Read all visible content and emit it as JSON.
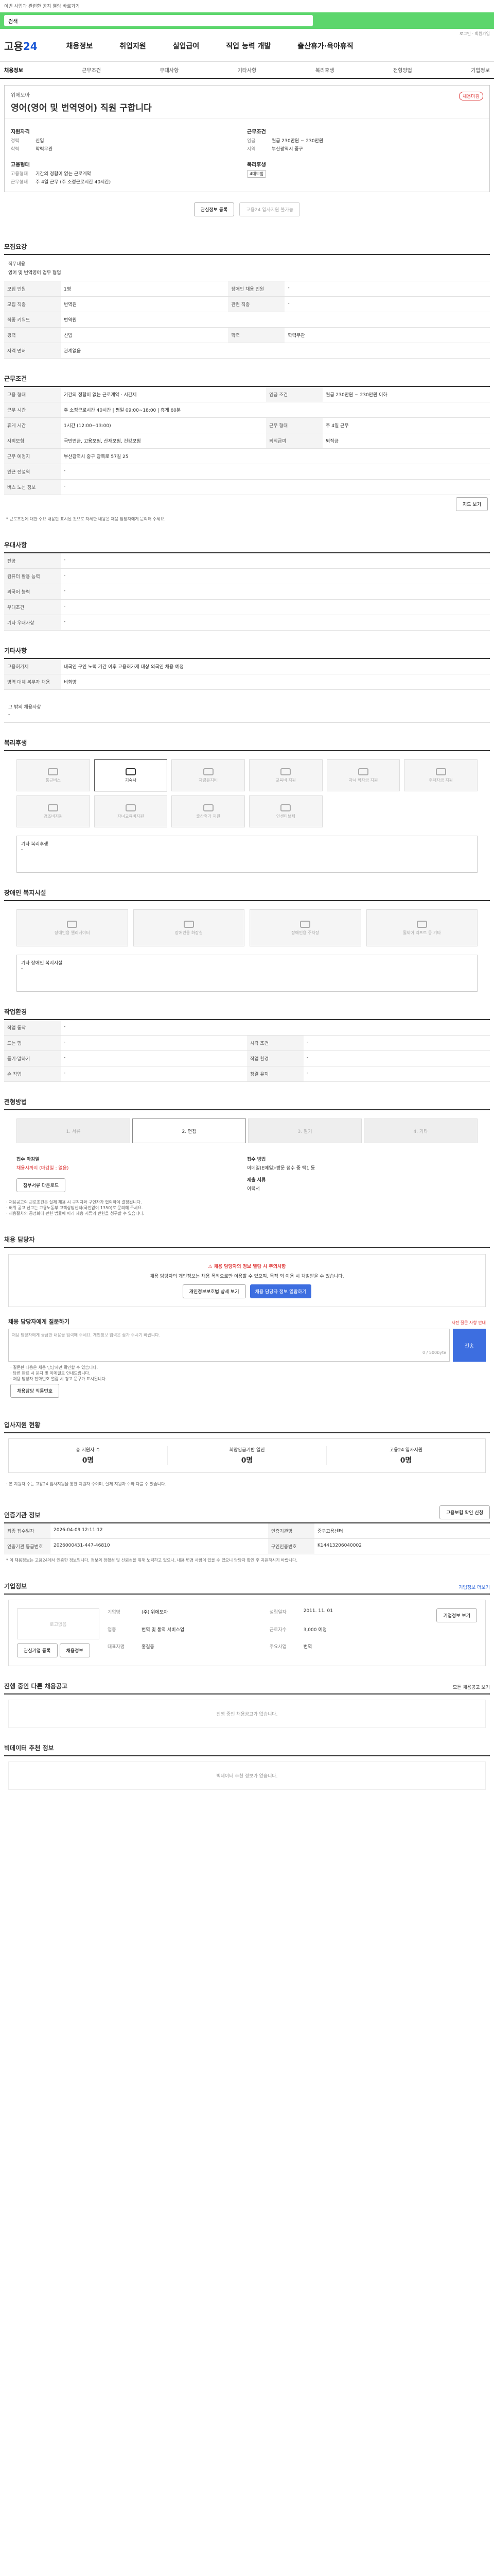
{
  "header": {
    "notice": "이번 사업과 관련한 공지 열람 바로가기",
    "search_value": "검색",
    "logo_a": "고용",
    "logo_b": "24",
    "nav": [
      "채용정보",
      "취업지원",
      "실업급여",
      "직업 능력 개발",
      "출산휴가·육아휴직"
    ],
    "util": "로그인 · 회원가입"
  },
  "lnb": [
    "채용정보",
    "근무조건",
    "우대사항",
    "기타사항",
    "복리후생",
    "전형방법",
    "기업정보"
  ],
  "job": {
    "company": "위에모아",
    "title": "영어(영어 및 번역영어) 직원 구합니다",
    "badge": "채용마감",
    "qual_title": "지원자격",
    "qual": [
      [
        "경력",
        "신입"
      ],
      [
        "학력",
        "학력무관"
      ]
    ],
    "qual2_title": "고용형태",
    "qual2": [
      [
        "고용형태",
        "기간의 정함이 없는 근로계약"
      ],
      [
        "근무형태",
        "주 4일 근무 (주 소정근로시간 40시간)"
      ]
    ],
    "cond_title": "근무조건",
    "cond": [
      [
        "임금",
        "월급 230만원 ~ 230만원"
      ],
      [
        "지역",
        "부산광역시 중구"
      ]
    ],
    "welfare_title": "복리후생",
    "welfare_tag": "4대보험",
    "btn_scrap": "관심정보 등록",
    "btn_apply": "고용24 입사지원 불가능"
  },
  "sec_recruit": {
    "title": "모집요강",
    "duty_label": "직무내용",
    "duty": "영어 및 번역영어 업무 협업",
    "rows": [
      [
        "모집 인원",
        "1명",
        "장애인 채용 인원",
        "-"
      ],
      [
        "모집 직종",
        "번역원",
        "관련 직종",
        "-"
      ],
      [
        "직종 키워드",
        "번역원",
        "",
        ""
      ],
      [
        "경력",
        "신입",
        "학력",
        "학력무관"
      ],
      [
        "자격 면허",
        "관계없음",
        "",
        ""
      ]
    ]
  },
  "sec_cond": {
    "title": "근무조건",
    "rows": [
      [
        "고용 형태",
        "기간의 정함이 없는 근로계약 · 시간제",
        "임금 조건",
        "월급 230만원 ~ 230만원 이하"
      ],
      [
        "근무 시간",
        "주 소정근로시간 40시간 | 평일 09:00~18:00 | 휴게 60분",
        "",
        ""
      ],
      [
        "휴게 시간",
        "1시간 (12:00~13:00)",
        "근무 형태",
        "주 4일 근무"
      ],
      [
        "사회보험",
        "국민연금, 고용보험, 산재보험, 건강보험",
        "퇴직급여",
        "퇴직금"
      ],
      [
        "근무 예정지",
        "부산광역시 중구 광복로 57길 25",
        "",
        ""
      ],
      [
        "인근 전철역",
        "-",
        "",
        ""
      ],
      [
        "버스 노선 정보",
        "-",
        "",
        ""
      ]
    ],
    "map_btn": "지도 보기",
    "note": "* 근로조건에 대한 주요 내용만 표시된 것으로 자세한 내용은 채용 담당자에게 문의해 주세요."
  },
  "sec_pref": {
    "title": "우대사항",
    "rows": [
      [
        "전공",
        "-"
      ],
      [
        "컴퓨터 활용 능력",
        "-"
      ],
      [
        "외국어 능력",
        "-"
      ],
      [
        "우대조건",
        "-"
      ],
      [
        "기타 우대사항",
        "-"
      ]
    ]
  },
  "sec_etc": {
    "title": "기타사항",
    "rows": [
      [
        "고용허가제",
        "내국인 구인 노력 기간 이후 고용허가제 대상 외국인 채용 예정"
      ],
      [
        "병역 대체 복무자 채용",
        "비희망"
      ]
    ],
    "extra_label": "그 밖의 채용사항",
    "extra": "-"
  },
  "sec_welfare": {
    "title": "복리후생",
    "items": [
      "통근버스",
      "기숙사",
      "차량유지비",
      "교육비 지원",
      "자녀 학자금 지원",
      "주택자금 지원",
      "경조비지원",
      "자녀교육비지원",
      "출산휴가 지원",
      "인센티브제"
    ],
    "active": 1,
    "other_label": "기타 복리후생",
    "other": "-"
  },
  "sec_disabled": {
    "title": "장애인 복지시설",
    "items": [
      "장애인용 엘리베이터",
      "장애인용 화장실",
      "장애인용 주차장",
      "휠체어 리프트 등 기타"
    ],
    "other_label": "기타 장애인 복지시설",
    "other": "-"
  },
  "sec_env": {
    "title": "작업환경",
    "rows": [
      [
        "작업 동작",
        "-",
        "",
        ""
      ],
      [
        "드는 힘",
        "-",
        "시각 조건",
        "-"
      ],
      [
        "듣기·말하기",
        "-",
        "작업 환경",
        "-"
      ],
      [
        "손 작업",
        "-",
        "청결 유지",
        "-"
      ]
    ]
  },
  "sec_process": {
    "title": "전형방법",
    "steps": [
      "1. 서류",
      "2. 면접",
      "3. 필기",
      "4. 기타"
    ],
    "active": 1,
    "deadline_label": "접수 마감일",
    "deadline": "채용시까지 (마감일 : 없음)",
    "method_label": "접수 방법",
    "method": "이메일(E메일)·방문 접수 중 택1 등",
    "docs_label": "제출 서류",
    "docs": "이력서",
    "doc_btn": "첨부서류 다운로드",
    "notes": [
      "· 채용공고의 근로조건은 실제 채용 시 구직자와 구인자가 협의하여 결정됩니다.",
      "· 허위 공고 신고는 고용노동부 고객상담센터(국번없이 1350)로 문의해 주세요.",
      "· 채용절차의 공정화에 관한 법률에 따라 채용 서류의 반환을 청구할 수 있습니다."
    ]
  },
  "sec_manager": {
    "title": "채용 담당자",
    "warn_title": "채용 담당자의 정보 열람 시 주의사항",
    "warn_body": "채용 담당자의 개인정보는 채용 목적으로만 이용할 수 있으며, 목적 외 이용 시 처벌받을 수 있습니다.",
    "btn_view": "개인정보보호법 상세 보기",
    "btn_confirm": "채용 담당자 정보 열람하기",
    "qna_label": "채용 담당자에게 질문하기",
    "qna_note": "사전 질문 사항 안내",
    "qna_placeholder": "채용 담당자에게 궁금한 내용을 입력해 주세요. 개인정보 입력은 삼가 주시기 바랍니다.",
    "qna_count": "0 / 500byte",
    "qna_btn": "전송",
    "foot": [
      "· 질문한 내용은 채용 담당자만 확인할 수 있습니다.",
      "· 답변 완료 시 문자 및 이메일로 안내드립니다.",
      "· 채용 담당자 전화번호 열람 시 경고 문구가 표시됩니다."
    ],
    "foot_btn": "채용담당 직통번호"
  },
  "sec_status": {
    "title": "입사지원 현황",
    "items": [
      [
        "총 지원자 수",
        "0명"
      ],
      [
        "희망임금기반 열진",
        "0명"
      ],
      [
        "고용24 입사지원",
        "0명"
      ]
    ],
    "note": "· 본 지원자 수는 고용24 입사지원을 통한 지원자 수이며, 실제 지원자 수와 다를 수 있습니다."
  },
  "sec_info": {
    "title": "인증기관 정보",
    "btn": "고용보험 확인 신청",
    "rows": [
      [
        "최종 접수일자",
        "2026-04-09 12:11:12",
        "인증기관명",
        "중구고용센터"
      ],
      [
        "인증기관 등급번호",
        "2026000431-447-46810",
        "구인인증번호",
        "K14413206040002"
      ]
    ],
    "note": "* 이 채용정보는 고용24에서 인증한 정보입니다. 정보의 정확성 및 신뢰성을 위해 노력하고 있으나, 내용 변경 사항이 있을 수 있으니 담당자 확인 후 지원하시기 바랍니다."
  },
  "sec_company": {
    "title": "기업정보",
    "link": "기업정보 더보기",
    "logo_text": "로고없음",
    "btn1": "관심기업 등록",
    "btn2": "채용정보",
    "rows": [
      [
        "기업명",
        "(주) 위에모아",
        "설립일자",
        "2011. 11. 01"
      ],
      [
        "업종",
        "번역 및 통역 서비스업",
        "근로자수",
        "3,000 예정"
      ],
      [
        "대표자명",
        "홍길동",
        "주요사업",
        "번역"
      ]
    ],
    "more": "기업정보 보기"
  },
  "sec_related": {
    "title": "진행 중인 다른 채용공고",
    "sub": "모든 채용공고 보기",
    "empty": "진행 중인 채용공고가 없습니다."
  },
  "sec_recommend": {
    "title": "빅데이터 추천 정보",
    "empty": "빅데이터 추천 정보가 없습니다."
  }
}
